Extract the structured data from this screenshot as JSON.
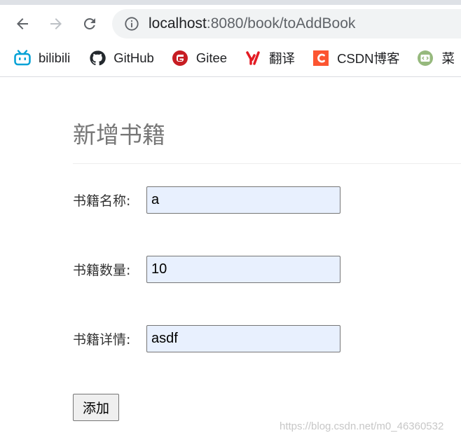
{
  "browser": {
    "url_host": "localhost",
    "url_rest": ":8080/book/toAddBook",
    "bookmarks": [
      {
        "label": "bilibili",
        "icon": "bilibili-icon",
        "color": "#00a1d6"
      },
      {
        "label": "GitHub",
        "icon": "github-icon",
        "color": "#24292e"
      },
      {
        "label": "Gitee",
        "icon": "gitee-icon",
        "color": "#c71d23"
      },
      {
        "label": "翻译",
        "icon": "youdao-icon",
        "color": "#e31b23"
      },
      {
        "label": "CSDN博客",
        "icon": "csdn-icon",
        "color": "#fc5531"
      },
      {
        "label": "菜",
        "icon": "runoob-icon",
        "color": "#96b97d"
      }
    ]
  },
  "form": {
    "title": "新增书籍",
    "fields": [
      {
        "label": "书籍名称:",
        "value": "a"
      },
      {
        "label": "书籍数量:",
        "value": "10"
      },
      {
        "label": "书籍详情:",
        "value": "asdf"
      }
    ],
    "submit_label": "添加"
  },
  "watermark": "https://blog.csdn.net/m0_46360532"
}
